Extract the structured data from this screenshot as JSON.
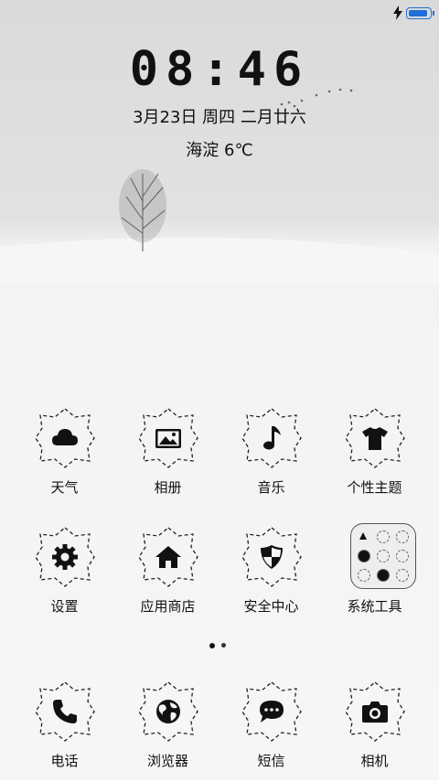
{
  "status_bar": {
    "battery_level": 0.9,
    "charging_icon": "bolt-icon",
    "accent": "#1f6fd6"
  },
  "lockscreen": {
    "time": "08:46",
    "date": "3月23日 周四 二月廿六",
    "weather": "海淀 6℃"
  },
  "apps": [
    {
      "label": "天气",
      "icon": "cloud-icon"
    },
    {
      "label": "相册",
      "icon": "image-icon"
    },
    {
      "label": "音乐",
      "icon": "music-note-icon"
    },
    {
      "label": "个性主题",
      "icon": "tshirt-icon"
    },
    {
      "label": "设置",
      "icon": "gear-icon"
    },
    {
      "label": "应用商店",
      "icon": "home-icon"
    },
    {
      "label": "安全中心",
      "icon": "shield-icon"
    },
    {
      "label": "系统工具",
      "icon": "folder-icon"
    }
  ],
  "page_indicator": {
    "pages": 2,
    "current": 1
  },
  "dock": [
    {
      "label": "电话",
      "icon": "phone-icon"
    },
    {
      "label": "浏览器",
      "icon": "globe-icon"
    },
    {
      "label": "短信",
      "icon": "message-icon"
    },
    {
      "label": "相机",
      "icon": "camera-icon"
    }
  ]
}
